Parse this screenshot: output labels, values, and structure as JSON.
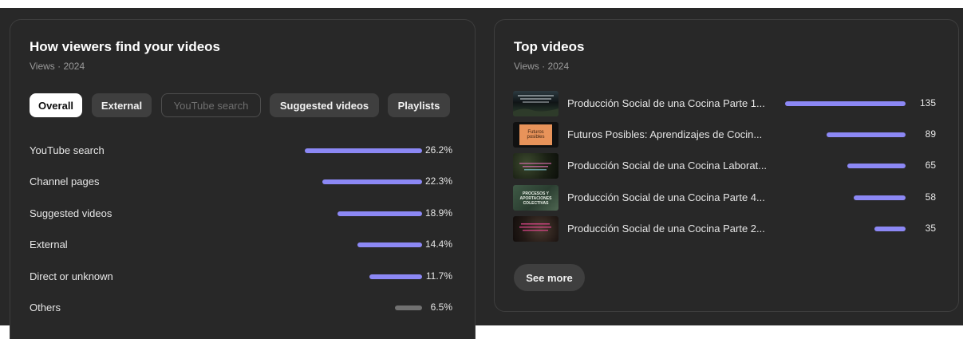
{
  "traffic": {
    "title": "How viewers find your videos",
    "subtitle": "Views · 2024",
    "tabs": [
      {
        "label": "Overall",
        "state": "active"
      },
      {
        "label": "External",
        "state": "normal"
      },
      {
        "label": "YouTube search",
        "state": "disabled"
      },
      {
        "label": "Suggested videos",
        "state": "normal"
      },
      {
        "label": "Playlists",
        "state": "normal"
      }
    ],
    "sources": [
      {
        "label": "YouTube search",
        "percent": "26.2%",
        "value": 26.2
      },
      {
        "label": "Channel pages",
        "percent": "22.3%",
        "value": 22.3
      },
      {
        "label": "Suggested videos",
        "percent": "18.9%",
        "value": 18.9
      },
      {
        "label": "External",
        "percent": "14.4%",
        "value": 14.4
      },
      {
        "label": "Direct or unknown",
        "percent": "11.7%",
        "value": 11.7
      },
      {
        "label": "Others",
        "percent": "6.5%",
        "value": 6.5
      }
    ],
    "bar_color": "#8c88f5",
    "others_bar_color": "#717171"
  },
  "top_videos": {
    "title": "Top videos",
    "subtitle": "Views · 2024",
    "videos": [
      {
        "title": "Producción Social de una Cocina Parte 1...",
        "views": "135",
        "value": 135,
        "thumb": "dark-landscape"
      },
      {
        "title": "Futuros Posibles: Aprendizajes de Cocin...",
        "views": "89",
        "value": 89,
        "thumb": "orange-card"
      },
      {
        "title": "Producción Social de una Cocina Laborat...",
        "views": "65",
        "value": 65,
        "thumb": "forest-dark"
      },
      {
        "title": "Producción Social de una Cocina Parte 4...",
        "views": "58",
        "value": 58,
        "thumb": "green-text"
      },
      {
        "title": "Producción Social de una Cocina Parte 2...",
        "views": "35",
        "value": 35,
        "thumb": "forest-pink"
      }
    ],
    "thumb_texts": {
      "video2": "Futuros posibles",
      "video4": "PROCESOS Y APORTACIONES COLECTIVAS"
    },
    "see_more": "See more"
  }
}
